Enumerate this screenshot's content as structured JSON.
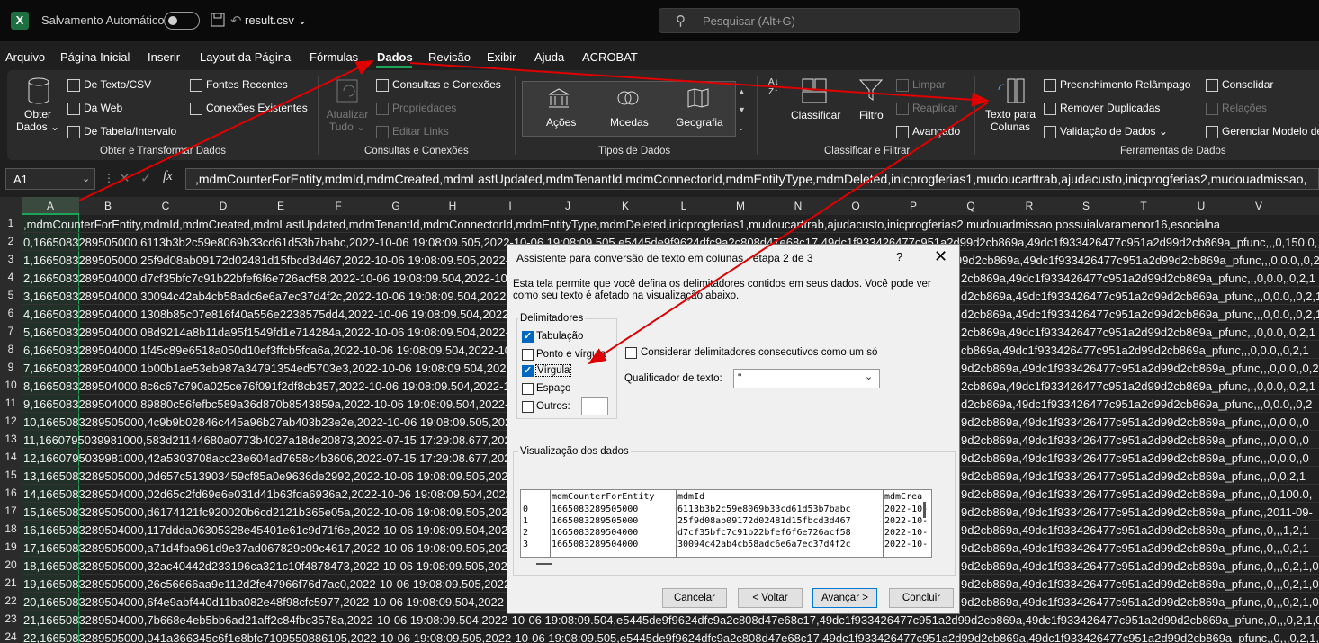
{
  "titlebar": {
    "autosave_label": "Salvamento Automático",
    "filename": "result.csv",
    "search_placeholder": "Pesquisar (Alt+G)"
  },
  "menu": {
    "tabs": [
      "Arquivo",
      "Página Inicial",
      "Inserir",
      "Layout da Página",
      "Fórmulas",
      "Dados",
      "Revisão",
      "Exibir",
      "Ajuda",
      "ACROBAT"
    ],
    "active_tab": "Dados"
  },
  "ribbon": {
    "obter": {
      "get_data": "Obter",
      "get_data2": "Dados",
      "from_text": "De Texto/CSV",
      "from_web": "Da Web",
      "from_table": "De Tabela/Intervalo",
      "recent_sources": "Fontes Recentes",
      "existing_connections": "Conexões Existentes",
      "group_label": "Obter e Transformar Dados"
    },
    "consultas": {
      "refresh_all": "Atualizar",
      "refresh_all2": "Tudo",
      "queries_connections": "Consultas e Conexões",
      "properties": "Propriedades",
      "edit_links": "Editar Links",
      "group_label": "Consultas e Conexões"
    },
    "tipos": {
      "stocks": "Ações",
      "currencies": "Moedas",
      "geography": "Geografia",
      "group_label": "Tipos de Dados"
    },
    "classificar": {
      "sort": "Classificar",
      "filter": "Filtro",
      "clear": "Limpar",
      "reapply": "Reaplicar",
      "advanced": "Avançado",
      "group_label": "Classificar e Filtrar"
    },
    "ferramentas": {
      "text_to_columns": "Texto para",
      "text_to_columns2": "Colunas",
      "flash_fill": "Preenchimento Relâmpago",
      "remove_duplicates": "Remover Duplicadas",
      "data_validation": "Validação de Dados",
      "consolidate": "Consolidar",
      "relationships": "Relações",
      "manage_model": "Gerenciar Modelo de",
      "group_label": "Ferramentas de Dados"
    }
  },
  "formula_bar": {
    "name_box": "A1",
    "formula": ",mdmCounterForEntity,mdmId,mdmCreated,mdmLastUpdated,mdmTenantId,mdmConnectorId,mdmEntityType,mdmDeleted,inicprogferias1,mudoucarttrab,ajudacusto,inicprogferias2,mudouadmissao,"
  },
  "grid": {
    "columns": [
      "A",
      "B",
      "C",
      "D",
      "E",
      "F",
      "G",
      "H",
      "I",
      "J",
      "K",
      "L",
      "M",
      "N",
      "O",
      "P",
      "Q",
      "R",
      "S",
      "T",
      "U",
      "V"
    ],
    "rows": [
      {
        "n": "1",
        "left": ",mdmCounterForEntity,mdmId,mdmCreated,mdmLastUpdated,mdmTenantId,mdmConnectorId,mdmEntityType,mdmDeleted,inicprogferias1,mudoucarttrab,ajudacusto,inicprogferias2,mudouadmissao,possuialvaramenor16,esocialna",
        "right": ""
      },
      {
        "n": "2",
        "left": "0,1665083289505000,6113b3b2c59e8069b33cd61d53b7babc,2022-10-06 19:08:09.505,2022-10-06 19:08:09.505,e5445de9f9624dfc9a2c808d47e68c17,49dc1f933426477c951a2d99d2cb869a,49dc1f933426477c951a2d99d2cb869a_pfunc,,,0,150.0,,0",
        "right": ""
      },
      {
        "n": "3",
        "left": "1,1665083289505000,25f9d08ab09172d02481d15fbcd3d467,2022-10-06 19:08:09.505,2022-10-06 19:08:09.505,e5445de9f9624dfc9a2c808d47e68c17,49dc1f933426477c951a2d99d2cb869a,49dc1f933426477c951a2d99d2cb869a_pfunc,,,0,0.0,,0,2",
        "right": ""
      },
      {
        "n": "4",
        "left": "2,1665083289504000,d7cf35bfc7c91b22bfef6f6e726acf58,2022-10-06 19:08:09.504,2022-10",
        "right": "2cb869a,49dc1f933426477c951a2d99d2cb869a_pfunc,,,0,0.0,,0,2,1"
      },
      {
        "n": "5",
        "left": "3,1665083289504000,30094c42ab4cb58adc6e6a7ec37d4f2c,2022-10-06 19:08:09.504,2022-10",
        "right": "d2cb869a,49dc1f933426477c951a2d99d2cb869a_pfunc,,,0,0.0,,0,2,1"
      },
      {
        "n": "6",
        "left": "4,1665083289504000,1308b85c07e816f40a556e2238575dd4,2022-10-06 19:08:09.504,2022-10",
        "right": "d2cb869a,49dc1f933426477c951a2d99d2cb869a_pfunc,,,0,0.0,,0,2,1"
      },
      {
        "n": "7",
        "left": "5,1665083289504000,08d9214a8b11da95f1549fd1e714284a,2022-10-06 19:08:09.504,2022-10",
        "right": "2cb869a,49dc1f933426477c951a2d99d2cb869a_pfunc,,,0,0.0,,0,2,1"
      },
      {
        "n": "8",
        "left": "6,1665083289504000,1f45c89e6518a050d10ef3ffcb5fca6a,2022-10-06 19:08:09.504,2022-10",
        "right": "cb869a,49dc1f933426477c951a2d99d2cb869a_pfunc,,,0,0.0,,0,2,1"
      },
      {
        "n": "9",
        "left": "7,1665083289504000,1b00b1ae53eb987a34791354ed5703e3,2022-10-06 19:08:09.504,2022-10",
        "right": "9d2cb869a,49dc1f933426477c951a2d99d2cb869a_pfunc,,,0,0.0,,0,2"
      },
      {
        "n": "10",
        "left": "8,1665083289504000,8c6c67c790a025ce76f091f2df8cb357,2022-10-06 19:08:09.504,2022-10",
        "right": "2cb869a,49dc1f933426477c951a2d99d2cb869a_pfunc,,,0,0.0,,0,2,1"
      },
      {
        "n": "11",
        "left": "9,1665083289504000,89880c56fefbc589a36d870b8543859a,2022-10-06 19:08:09.504,2022-10",
        "right": "d2cb869a,49dc1f933426477c951a2d99d2cb869a_pfunc,,,0,0.0,,0,2"
      },
      {
        "n": "12",
        "left": "10,1665083289505000,4c9b9b02846c445a96b27ab403b23e2e,2022-10-06 19:08:09.505,2022-1",
        "right": "9d2cb869a,49dc1f933426477c951a2d99d2cb869a_pfunc,,,0,0.0,,0"
      },
      {
        "n": "13",
        "left": "11,1660795039981000,583d21144680a0773b4027a18de20873,2022-07-15 17:29:08.677,2022-1",
        "right": "9d2cb869a,49dc1f933426477c951a2d99d2cb869a_pfunc,,,0,0.0,,0"
      },
      {
        "n": "14",
        "left": "12,1660795039981000,42a5303708acc23e604ad7658c4b3606,2022-07-15 17:29:08.677,2022-1",
        "right": "9d2cb869a,49dc1f933426477c951a2d99d2cb869a_pfunc,,,0,0.0,,0"
      },
      {
        "n": "15",
        "left": "13,1665083289505000,0d657c513903459cf85a0e9636de2992,2022-10-06 19:08:09.505,2022-1",
        "right": "9d2cb869a,49dc1f933426477c951a2d99d2cb869a_pfunc,,,0,0,2,1"
      },
      {
        "n": "16",
        "left": "14,1665083289504000,02d65c2fd69e6e031d41b63fda6936a2,2022-10-06 19:08:09.504,2022-1",
        "right": "9d2cb869a,49dc1f933426477c951a2d99d2cb869a_pfunc,,,0,100.0,"
      },
      {
        "n": "17",
        "left": "15,1665083289505000,d6174121fc920020b6cd2121b365e05a,2022-10-06 19:08:09.505,2022-1",
        "right": "9d2cb869a,49dc1f933426477c951a2d99d2cb869a_pfunc,,2011-09-"
      },
      {
        "n": "18",
        "left": "16,1665083289504000,117ddda06305328e45401e61c9d71f6e,2022-10-06 19:08:09.504,2022-1",
        "right": "9d2cb869a,49dc1f933426477c951a2d99d2cb869a_pfunc,,0,,,1,2,1"
      },
      {
        "n": "19",
        "left": "17,1665083289505000,a71d4fba961d9e37ad067829c09c4617,2022-10-06 19:08:09.505,2022-1",
        "right": "9d2cb869a,49dc1f933426477c951a2d99d2cb869a_pfunc,,0,,,0,2,1"
      },
      {
        "n": "20",
        "left": "18,1665083289505000,32ac40442d233196ca321c10f4878473,2022-10-06 19:08:09.505,2022-1",
        "right": "9d2cb869a,49dc1f933426477c951a2d99d2cb869a_pfunc,,0,,,0,2,1,0"
      },
      {
        "n": "21",
        "left": "19,1665083289505000,26c56666aa9e112d2fe47966f76d7ac0,2022-10-06 19:08:09.505,2022-1",
        "right": "9d2cb869a,49dc1f933426477c951a2d99d2cb869a_pfunc,,0,,,0,2,1,0"
      },
      {
        "n": "22",
        "left": "20,1665083289504000,6f4e9abf440d11ba082e48f98cfc5977,2022-10-06 19:08:09.504,2022-1",
        "right": "9d2cb869a,49dc1f933426477c951a2d99d2cb869a_pfunc,,0,,,0,2,1,0"
      },
      {
        "n": "23",
        "left": "21,1665083289504000,7b668e4eb5bb6ad21aff2c84fbc3578a,2022-10-06 19:08:09.504,2022-10-06 19:08:09.504,e5445de9f9624dfc9a2c808d47e68c17,49dc1f933426477c951a2d99d2cb869a,49dc1f933426477c951a2d99d2cb869a_pfunc,,0,,,0,2,1,0",
        "right": ""
      },
      {
        "n": "24",
        "left": "22,1665083289505000,041a366345c6f1e8bfc7109550886105,2022-10-06 19:08:09.505,2022-10-06 19:08:09.505,e5445de9f9624dfc9a2c808d47e68c17,49dc1f933426477c951a2d99d2cb869a,49dc1f933426477c951a2d99d2cb869a_pfunc,,0,,,0,2,1,0",
        "right": ""
      }
    ]
  },
  "dialog": {
    "title": "Assistente para conversão de texto em colunas - etapa 2 de 3",
    "help": "?",
    "close": "✕",
    "description": "Esta tela permite que você defina os delimitadores contidos em seus dados. Você pode ver como seu texto é afetado na visualização abaixo.",
    "delimiters_legend": "Delimitadores",
    "tab_label": "Tabulação",
    "semicolon_label": "Ponto e vírgula",
    "comma_label": "Vírgula",
    "space_label": "Espaço",
    "other_label": "Outros:",
    "tab_checked": true,
    "semicolon_checked": false,
    "comma_checked": true,
    "space_checked": false,
    "other_checked": false,
    "consecutive_label": "Considerar delimitadores consecutivos como um só",
    "consecutive_checked": false,
    "qualifier_label": "Qualificador de texto:",
    "qualifier_value": "\"",
    "preview_legend": "Visualização dos dados",
    "preview_headers": [
      "",
      "mdmCounterForEntity",
      "mdmId",
      "mdmCrea"
    ],
    "preview_rows": [
      [
        "0",
        "1665083289505000",
        "6113b3b2c59e8069b33cd61d53b7babc",
        "2022-10-"
      ],
      [
        "1",
        "1665083289505000",
        "25f9d08ab09172d02481d15fbcd3d467",
        "2022-10-"
      ],
      [
        "2",
        "1665083289504000",
        "d7cf35bfc7c91b22bfef6f6e726acf58",
        "2022-10-"
      ],
      [
        "3",
        "1665083289504000",
        "30094c42ab4cb58adc6e6a7ec37d4f2c",
        "2022-10-"
      ]
    ],
    "cancel": "Cancelar",
    "back": "< Voltar",
    "next": "Avançar >",
    "finish": "Concluir"
  },
  "colors": {
    "excel_green": "#1d6f42",
    "selection_green": "#1ea45a",
    "annotation_red": "#e00000",
    "dialog_bg": "#f0f0f0",
    "checkbox_blue": "#0067c0"
  }
}
